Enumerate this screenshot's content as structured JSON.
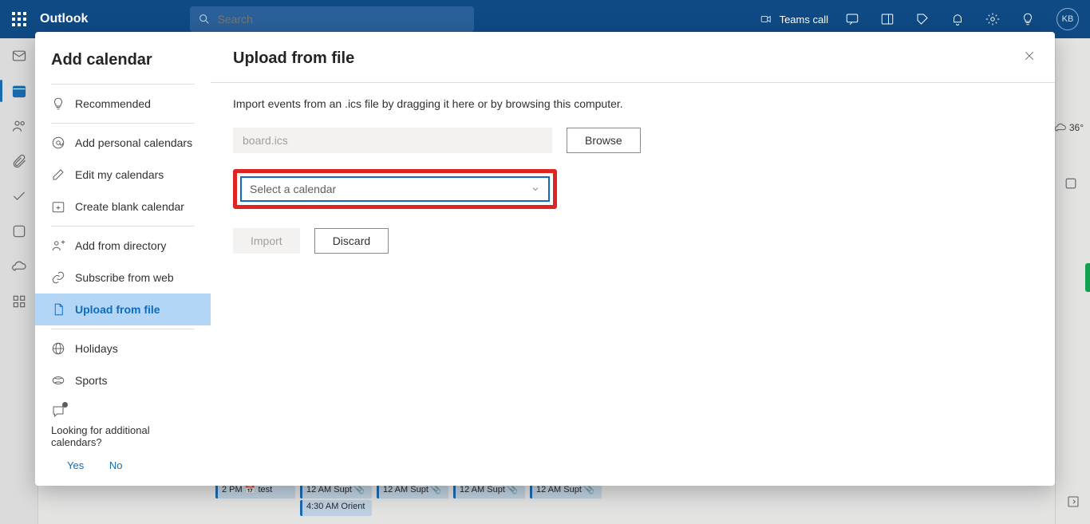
{
  "header": {
    "brand": "Outlook",
    "search_placeholder": "Search",
    "teams_label": "Teams call",
    "avatar_initials": "KB"
  },
  "weather": {
    "temp": "36°"
  },
  "bg_events": {
    "e1": "2 PM  📅 test",
    "e2a": "12 AM Supt 📎",
    "e2b": "4:30 AM Orient",
    "e3": "12 AM Supt 📎",
    "e4": "12 AM Supt 📎",
    "e5": "12 AM Supt 📎"
  },
  "modal": {
    "sidebar_title": "Add calendar",
    "items": {
      "recommended": "Recommended",
      "add_personal": "Add personal calendars",
      "edit": "Edit my calendars",
      "blank": "Create blank calendar",
      "directory": "Add from directory",
      "subscribe": "Subscribe from web",
      "upload": "Upload from file",
      "holidays": "Holidays",
      "sports": "Sports"
    },
    "looking": "Looking for additional calendars?",
    "yes": "Yes",
    "no": "No",
    "main_title": "Upload from file",
    "hint": "Import events from an .ics file by dragging it here or by browsing this computer.",
    "file_value": "board.ics",
    "browse": "Browse",
    "select_placeholder": "Select a calendar",
    "import": "Import",
    "discard": "Discard"
  }
}
